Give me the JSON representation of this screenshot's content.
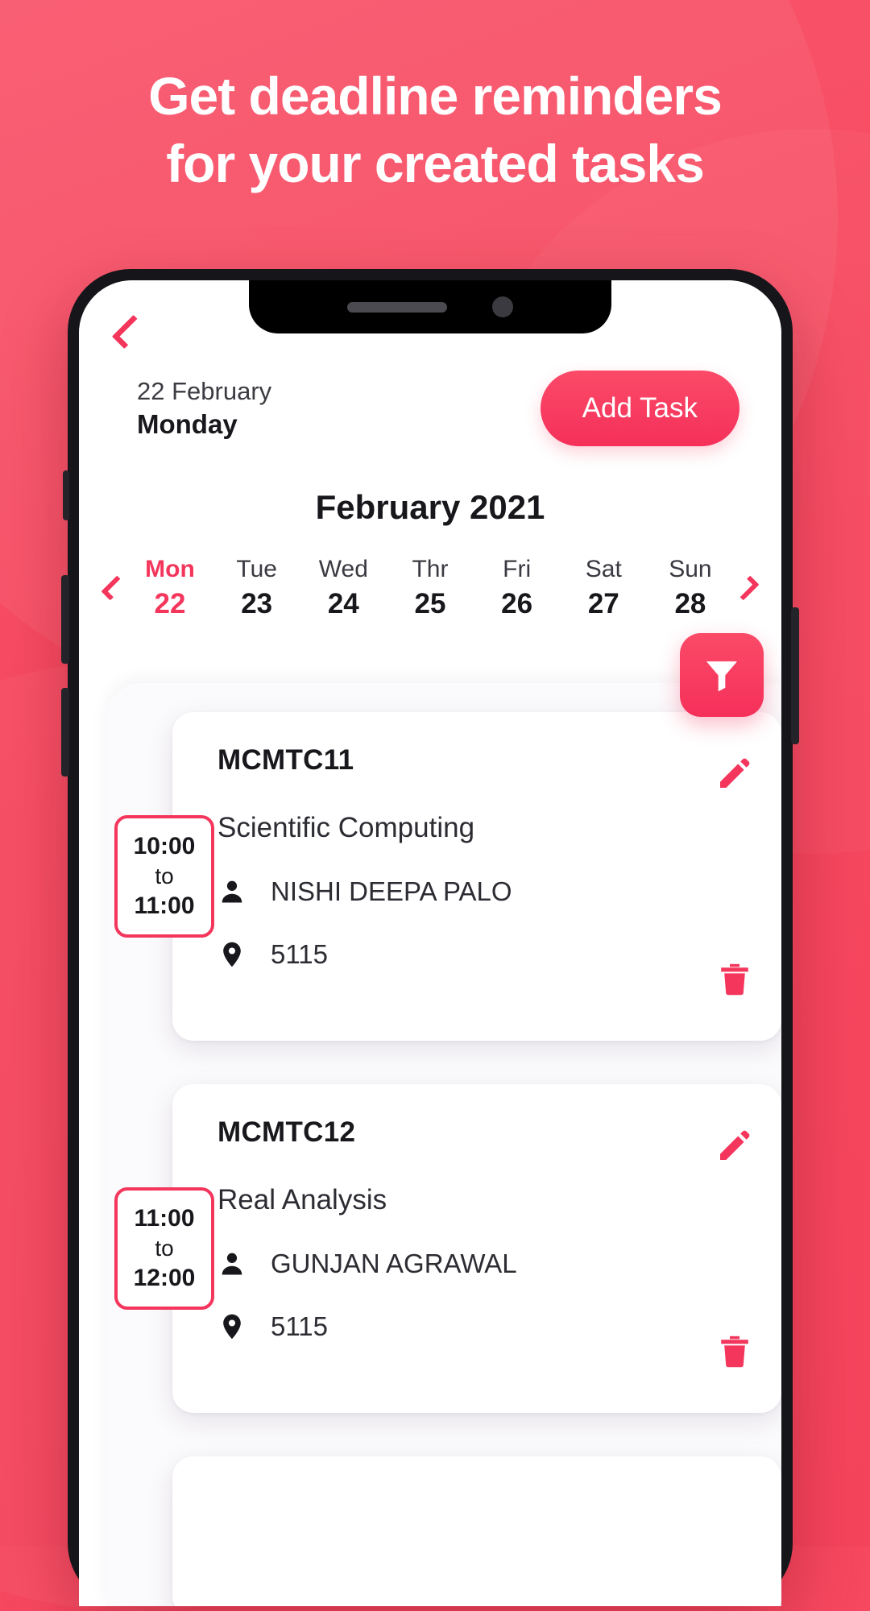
{
  "promo": {
    "headline_line1": "Get deadline reminders",
    "headline_line2": "for your created tasks",
    "background_color": "#f6485f",
    "accent_color": "#f4365c"
  },
  "app": {
    "back_icon": "chevron-left-icon",
    "header": {
      "date_label": "22 February",
      "weekday_label": "Monday",
      "add_task_label": "Add Task"
    },
    "calendar": {
      "month_title": "February 2021",
      "prev_icon": "chevron-left-icon",
      "next_icon": "chevron-right-icon",
      "days": [
        {
          "name": "Mon",
          "num": "22",
          "active": true
        },
        {
          "name": "Tue",
          "num": "23",
          "active": false
        },
        {
          "name": "Wed",
          "num": "24",
          "active": false
        },
        {
          "name": "Thr",
          "num": "25",
          "active": false
        },
        {
          "name": "Fri",
          "num": "26",
          "active": false
        },
        {
          "name": "Sat",
          "num": "27",
          "active": false
        },
        {
          "name": "Sun",
          "num": "28",
          "active": false
        }
      ]
    },
    "filter_button": {
      "icon": "funnel-icon"
    },
    "tasks": [
      {
        "start_time": "10:00",
        "separator": "to",
        "end_time": "11:00",
        "code": "MCMTC11",
        "title": "Scientific Computing",
        "person_icon": "person-icon",
        "person": "NISHI DEEPA PALO",
        "location_icon": "map-pin-icon",
        "location": "5115",
        "edit_icon": "pencil-icon",
        "delete_icon": "trash-icon"
      },
      {
        "start_time": "11:00",
        "separator": "to",
        "end_time": "12:00",
        "code": "MCMTC12",
        "title": "Real Analysis",
        "person_icon": "person-icon",
        "person": "GUNJAN AGRAWAL",
        "location_icon": "map-pin-icon",
        "location": "5115",
        "edit_icon": "pencil-icon",
        "delete_icon": "trash-icon"
      }
    ]
  }
}
